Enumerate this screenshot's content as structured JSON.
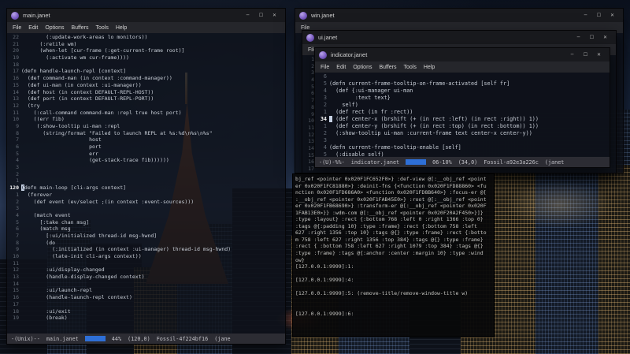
{
  "window_controls": {
    "minimize": "─",
    "maximize": "☐",
    "close": "✕"
  },
  "windows": {
    "main": {
      "title": "main.janet",
      "menu": [
        "File",
        "Edit",
        "Options",
        "Buffers",
        "Tools",
        "Help"
      ],
      "code": [
        {
          "n": "22",
          "t": "        (:update-work-areas lo monitors))"
        },
        {
          "n": "21",
          "t": "      (:retile wm)"
        },
        {
          "n": "20",
          "t": "      (when-let [cur-frame (:get-current-frame root)]"
        },
        {
          "n": "19",
          "t": "        (:activate wm cur-frame))))"
        },
        {
          "n": "18",
          "t": ""
        },
        {
          "n": "17",
          "t": "(defn handle-launch-repl [context]"
        },
        {
          "n": "16",
          "t": "  (def command-man (in context :command-manager))"
        },
        {
          "n": "15",
          "t": "  (def ui-man (in context :ui-manager))"
        },
        {
          "n": "14",
          "t": "  (def host (in context DEFAULT-REPL-HOST))"
        },
        {
          "n": "13",
          "t": "  (def port (in context DEFAULT-REPL-PORT))"
        },
        {
          "n": "12",
          "t": "  (try"
        },
        {
          "n": "11",
          "t": "    (:call-command command-man :repl true host port)"
        },
        {
          "n": "10",
          "t": "    ((err fib)"
        },
        {
          "n": "9",
          "t": "     (:show-tooltip ui-man :repl"
        },
        {
          "n": "8",
          "t": "       (string/format \"Failed to launch REPL at %s:%d\\n%s\\n%s\""
        },
        {
          "n": "7",
          "t": "                      host"
        },
        {
          "n": "6",
          "t": "                      port"
        },
        {
          "n": "5",
          "t": "                      err"
        },
        {
          "n": "4",
          "t": "                      (get-stack-trace fib))))))"
        },
        {
          "n": "3",
          "t": ""
        },
        {
          "n": "2",
          "t": ""
        },
        {
          "n": "1",
          "t": ""
        },
        {
          "n": "120",
          "t": "(defn main-loop [cli-args context]",
          "cur": true
        },
        {
          "n": "1",
          "t": "  (forever"
        },
        {
          "n": "2",
          "t": "    (def event (ev/select ;(in context :event-sources)))"
        },
        {
          "n": "3",
          "t": ""
        },
        {
          "n": "4",
          "t": "    (match event"
        },
        {
          "n": "5",
          "t": "      [:take chan msg]"
        },
        {
          "n": "6",
          "t": "      (match msg"
        },
        {
          "n": "7",
          "t": "        [:ui/initialized thread-id msg-hwnd]"
        },
        {
          "n": "8",
          "t": "        (do"
        },
        {
          "n": "9",
          "t": "          (:initialized (in context :ui-manager) thread-id msg-hwnd)"
        },
        {
          "n": "10",
          "t": "          (late-init cli-args context))"
        },
        {
          "n": "11",
          "t": ""
        },
        {
          "n": "12",
          "t": "        :ui/display-changed"
        },
        {
          "n": "13",
          "t": "        (handle-display-changed context)"
        },
        {
          "n": "14",
          "t": ""
        },
        {
          "n": "15",
          "t": "        :ui/launch-repl"
        },
        {
          "n": "16",
          "t": "        (handle-launch-repl context)"
        },
        {
          "n": "17",
          "t": ""
        },
        {
          "n": "18",
          "t": "        :ui/exit"
        },
        {
          "n": "19",
          "t": "        (break)"
        }
      ],
      "modeline": {
        "mode": "-(Unix)--",
        "buffer": "main.janet",
        "percent": "44%",
        "pos": "(120,0)",
        "vc": "Fossil-4f224bf16",
        "tail": "(jane"
      }
    },
    "win": {
      "title": "win.janet",
      "menu": [
        "File"
      ]
    },
    "ui": {
      "title": "ui.janet",
      "menu": [
        "File"
      ],
      "code": [
        {
          "n": "1",
          "t": ""
        },
        {
          "n": "2",
          "t": ""
        },
        {
          "n": "3",
          "t": ""
        },
        {
          "n": "4",
          "t": ""
        },
        {
          "n": "5",
          "t": ""
        },
        {
          "n": "6",
          "t": ""
        },
        {
          "n": "7",
          "t": ""
        },
        {
          "n": "8",
          "t": ""
        },
        {
          "n": "9",
          "t": ""
        },
        {
          "n": "10",
          "t": ""
        },
        {
          "n": "11",
          "t": ""
        },
        {
          "n": "12",
          "t": ""
        },
        {
          "n": "13",
          "t": ""
        },
        {
          "n": "14",
          "t": ""
        },
        {
          "n": "15",
          "t": ""
        },
        {
          "n": "16",
          "t": ""
        },
        {
          "n": "17",
          "t": ""
        }
      ]
    },
    "indicator": {
      "title": "indicator.janet",
      "menu": [
        "File",
        "Edit",
        "Options",
        "Buffers",
        "Tools",
        "Help"
      ],
      "code": [
        {
          "n": "6",
          "t": ""
        },
        {
          "n": "5",
          "t": "(defn current-frame-tooltip-on-frame-activated [self fr]"
        },
        {
          "n": "4",
          "t": "  (def {:ui-manager ui-man"
        },
        {
          "n": "3",
          "t": "        :text text}"
        },
        {
          "n": "2",
          "t": "    self)"
        },
        {
          "n": "1",
          "t": "  (def rect (in fr :rect))"
        },
        {
          "n": "34",
          "t": "  (def center-x (brshift (+ (in rect :left) (in rect :right)) 1))",
          "cur": true
        },
        {
          "n": "1",
          "t": "  (def center-y (brshift (+ (in rect :top) (in rect :bottom)) 1))"
        },
        {
          "n": "2",
          "t": "  (:show-tooltip ui-man :current-frame text center-x center-y))"
        },
        {
          "n": "3",
          "t": ""
        },
        {
          "n": "4",
          "t": "(defn current-frame-tooltip-enable [self]"
        },
        {
          "n": "5",
          "t": "  (:disable self)"
        }
      ],
      "modeline": {
        "mode": "-(U)-%%-",
        "buffer": "indicator.janet",
        "percent": "06-10%",
        "pos": "(34,0)",
        "vc": "Fossil-a92e3a226c",
        "tail": "(janet"
      }
    }
  },
  "terminal": {
    "lines": [
      "bj_ref <pointer 0x020F1FC652F0>} :def-view @[:__obj_ref <point",
      "er 0x020F1FC81880>} :deinit-fns {<function 0x020F1FD88860> <fu",
      "nction 0x020F1FD686A0> <function 0x020F1FD8B640>} :focus-er @[",
      ":__obj_ref <pointer 0x020F1FAB45E0>} :root @[:__obj_ref <point",
      "er 0x020F1FB68690>} :transform-er @[:__obj_ref <pointer 0x020F",
      "1FAB13E0>}} :wdm-com @[:__obj_ref <pointer 0x020F20A2F450>}]}",
      ":type :layout} :rect {:bottom 768 :left 0 :right 1366 :top 0}",
      ":tags @{:padding 10} :type :frame} :rect {:bottom 758 :left",
      "627 :right 1356 :top 10} :tags @{} :type :frame} :rect {:botto",
      "m 758 :left 627 :right 1356 :top 384} :tags @{} :type :frame}",
      ":rect { :bottom 758 :left 627 :right 1079 :top 384} :tags @{}",
      ":type :frame} :tags @{:anchor :center :margin 10} :type :wind",
      "ow}",
      "[127.0.0.1:9999]:1:",
      "",
      "[127.0.0.1:9999]:4:",
      "",
      "[127.0.0.1:9999]:5: (remove-title/remove-window-title w)",
      "",
      "",
      "[127.0.0.1:9999]:6:"
    ]
  }
}
